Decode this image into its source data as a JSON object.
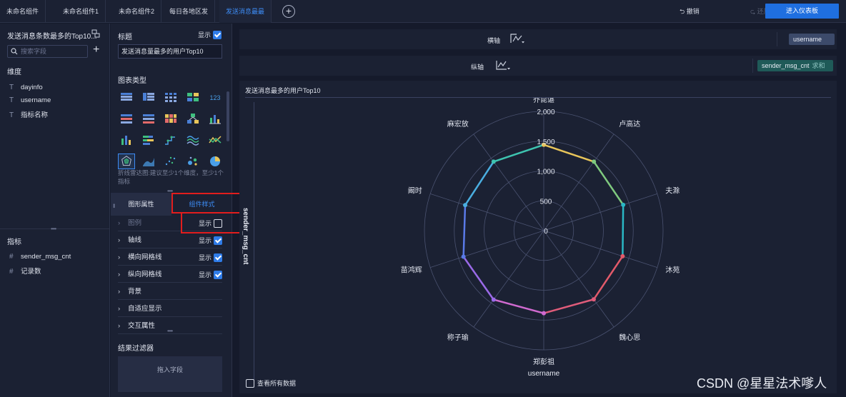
{
  "tabs": [
    {
      "label": "未命名组件"
    },
    {
      "label": "未命名组件1"
    },
    {
      "label": "未命名组件2"
    },
    {
      "label": "每日各地区发"
    },
    {
      "label": "发送消息最最"
    }
  ],
  "toolbar": {
    "undo": "撤销",
    "redo": "还原",
    "enter_dashboard": "进入仪表板"
  },
  "left_panel": {
    "title": "发送消息条数最多的Top10...",
    "search_placeholder": "搜索字段",
    "dimensions_label": "维度",
    "dimensions": [
      {
        "type": "T",
        "name": "dayinfo"
      },
      {
        "type": "T",
        "name": "username"
      },
      {
        "type": "T",
        "name": "指标名称"
      }
    ],
    "measures_label": "指标",
    "measures": [
      {
        "type": "#",
        "name": "sender_msg_cnt"
      },
      {
        "type": "#",
        "name": "记录数"
      }
    ]
  },
  "config": {
    "title_label": "标题",
    "show_label": "显示",
    "title_value": "发送消息量最多的用户Top10",
    "chart_type_label": "图表类型",
    "hint": "折线雷达图:建议至少1个维度，至少1个指标",
    "tab_graph_props": "图形属性",
    "tab_component_style": "组件样式",
    "props": [
      {
        "label": "图例",
        "show": "显示",
        "checked": false
      },
      {
        "label": "轴线",
        "show": "显示",
        "checked": true
      },
      {
        "label": "横向网格线",
        "show": "显示",
        "checked": true
      },
      {
        "label": "纵向网格线",
        "show": "显示",
        "checked": true
      },
      {
        "label": "背景"
      },
      {
        "label": "自适应显示"
      },
      {
        "label": "交互属性"
      }
    ],
    "filter_label": "结果过滤器",
    "drop_zone": "拖入字段"
  },
  "axes": {
    "x_label": "横轴",
    "x_field": "username",
    "y_label": "纵轴",
    "y_field": "sender_msg_cnt",
    "y_agg": "求和"
  },
  "chart_card": {
    "title": "发送消息最多的用户Top10",
    "view_all": "查看所有数据"
  },
  "chart_data": {
    "type": "radar",
    "categories": [
      "乔昆谌",
      "卢高达",
      "夫滁",
      "沐苑",
      "魏心思",
      "郑彭祖",
      "称子瑜",
      "苗鸿辉",
      "阚时",
      "麻宏放"
    ],
    "values": [
      1440,
      1430,
      1400,
      1390,
      1425,
      1385,
      1430,
      1415,
      1385,
      1430
    ],
    "radial_axis_label": "sender_msg_cnt",
    "angular_axis_label": "username",
    "ticks": [
      "0",
      "500",
      "1,000",
      "1,500",
      "2,000"
    ],
    "rmax": 2000,
    "line_colors": [
      "#e8c55a",
      "#7fc97f",
      "#2ab7c4",
      "#e25a6a",
      "#e05c7a",
      "#d06ad0",
      "#9a6ae8",
      "#5a7ae8",
      "#4aaee0",
      "#3ec4b0"
    ]
  },
  "watermark": "CSDN @星星法术嗲人"
}
